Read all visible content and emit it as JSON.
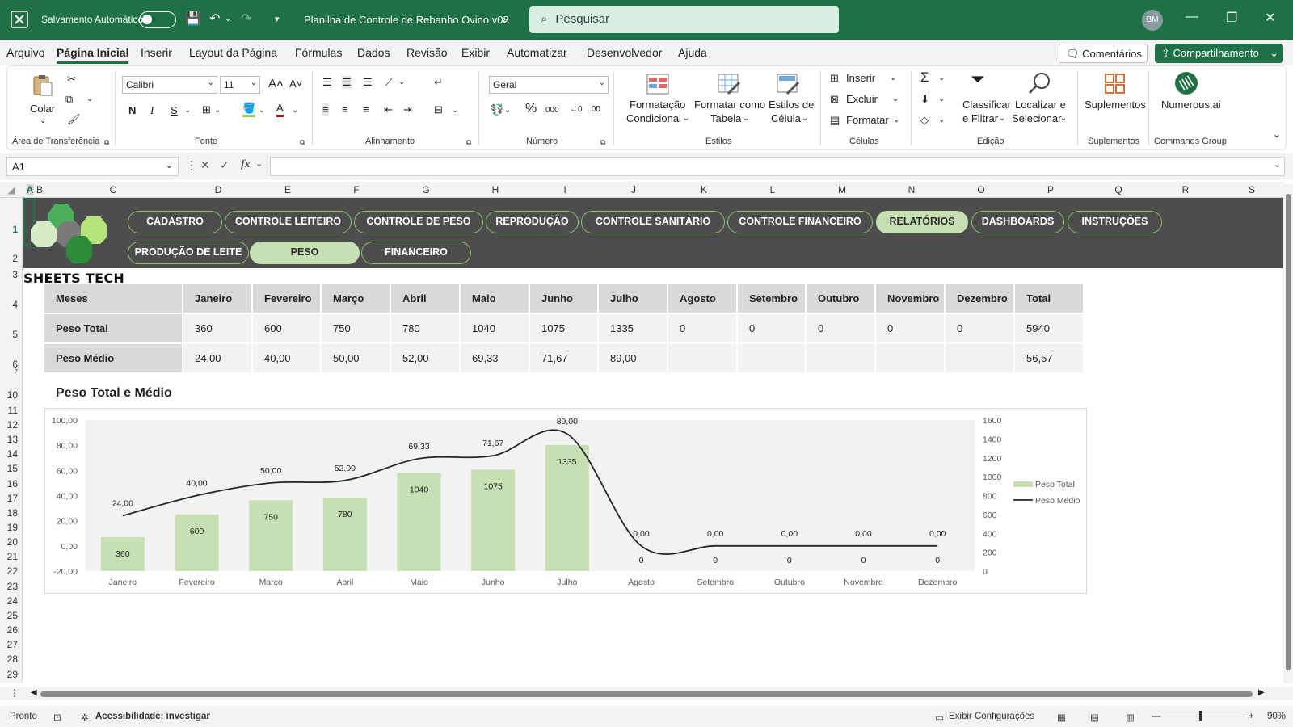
{
  "titlebar": {
    "autosave_label": "Salvamento Automático",
    "doc_title": "Planilha de Controle de Rebanho Ovino v08",
    "search_placeholder": "Pesquisar",
    "avatar_initials": "BM"
  },
  "menu": {
    "items": [
      "Arquivo",
      "Página Inicial",
      "Inserir",
      "Layout da Página",
      "Fórmulas",
      "Dados",
      "Revisão",
      "Exibir",
      "Automatizar",
      "Desenvolvedor",
      "Ajuda"
    ],
    "active": "Página Inicial",
    "comments_label": "Comentários",
    "share_label": "Compartilhamento"
  },
  "ribbon": {
    "paste": "Colar",
    "font_name": "Calibri",
    "font_size": "11",
    "bold": "N",
    "italic": "I",
    "underline": "S",
    "number_format": "Geral",
    "cond_format_1": "Formatação",
    "cond_format_2": "Condicional",
    "format_table_1": "Formatar como",
    "format_table_2": "Tabela",
    "cell_styles_1": "Estilos de",
    "cell_styles_2": "Célula",
    "insert": "Inserir",
    "delete": "Excluir",
    "format": "Formatar",
    "sort_1": "Classificar",
    "sort_2": "e Filtrar",
    "find_1": "Localizar e",
    "find_2": "Selecionar",
    "addins": "Suplementos",
    "numerous": "Numerous.ai",
    "groups": {
      "clipboard": "Área de Transferência",
      "font": "Fonte",
      "alignment": "Alinhamento",
      "number": "Número",
      "styles": "Estilos",
      "cells": "Células",
      "editing": "Edição",
      "addins": "Suplementos",
      "commands": "Commands Group"
    }
  },
  "formula": {
    "namebox": "A1",
    "fx": "fx",
    "content": ""
  },
  "columns": [
    "A",
    "B",
    "C",
    "D",
    "E",
    "F",
    "G",
    "H",
    "I",
    "J",
    "K",
    "L",
    "M",
    "N",
    "O",
    "P",
    "Q",
    "R",
    "S"
  ],
  "rows": [
    "1",
    "2",
    "3",
    "4",
    "5",
    "6",
    "7",
    "10",
    "11",
    "12",
    "13",
    "14",
    "15",
    "16",
    "17",
    "18",
    "19",
    "20",
    "21",
    "22",
    "23",
    "24",
    "25",
    "26",
    "27",
    "28",
    "29"
  ],
  "nav": {
    "row1": [
      "CADASTRO",
      "CONTROLE LEITEIRO",
      "CONTROLE DE PESO",
      "REPRODUÇÃO",
      "CONTROLE SANITÁRIO",
      "CONTROLE FINANCEIRO",
      "RELATÓRIOS",
      "DASHBOARDS",
      "INSTRUÇÕES"
    ],
    "row2": [
      "PRODUÇÃO DE LEITE",
      "PESO",
      "FINANCEIRO"
    ],
    "active_row1": "RELATÓRIOS",
    "active_row2": "PESO"
  },
  "brand": "SHEETS TECH",
  "table": {
    "header": [
      "Meses",
      "Janeiro",
      "Fevereiro",
      "Março",
      "Abril",
      "Maio",
      "Junho",
      "Julho",
      "Agosto",
      "Setembro",
      "Outubro",
      "Novembro",
      "Dezembro",
      "Total"
    ],
    "rows": [
      {
        "label": "Peso Total",
        "values": [
          "360",
          "600",
          "750",
          "780",
          "1040",
          "1075",
          "1335",
          "0",
          "0",
          "0",
          "0",
          "0",
          "5940"
        ]
      },
      {
        "label": "Peso Médio",
        "values": [
          "24,00",
          "40,00",
          "50,00",
          "52,00",
          "69,33",
          "71,67",
          "89,00",
          "",
          "",
          "",
          "",
          "",
          "56,57"
        ]
      }
    ]
  },
  "chart_data": {
    "type": "bar",
    "title": "Peso Total e Médio",
    "categories": [
      "Janeiro",
      "Fevereiro",
      "Março",
      "Abril",
      "Maio",
      "Junho",
      "Julho",
      "Agosto",
      "Setembro",
      "Outubro",
      "Novembro",
      "Dezembro"
    ],
    "series": [
      {
        "name": "Peso Total",
        "type": "bar",
        "axis": "right",
        "values": [
          360,
          600,
          750,
          780,
          1040,
          1075,
          1335,
          0,
          0,
          0,
          0,
          0
        ],
        "labels": [
          "360",
          "600",
          "750",
          "780",
          "1040",
          "1075",
          "1335",
          "0",
          "0",
          "0",
          "0",
          "0"
        ],
        "color": "#c6e0b4"
      },
      {
        "name": "Peso Médio",
        "type": "line",
        "axis": "left",
        "values": [
          24,
          40,
          50,
          52,
          69.33,
          71.67,
          89,
          0,
          0,
          0,
          0,
          0
        ],
        "labels": [
          "24,00",
          "40,00",
          "50,00",
          "52,00",
          "69,33",
          "71,67",
          "89,00",
          "0,00",
          "0,00",
          "0,00",
          "0,00",
          "0,00"
        ],
        "color": "#262626"
      }
    ],
    "y_left": {
      "min": -20,
      "max": 100,
      "ticks": [
        "100,00",
        "80,00",
        "60,00",
        "40,00",
        "20,00",
        "0,00",
        "-20,00"
      ]
    },
    "y_right": {
      "min": 0,
      "max": 1600,
      "ticks": [
        "1600",
        "1400",
        "1200",
        "1000",
        "800",
        "600",
        "400",
        "200",
        "0"
      ]
    },
    "legend_position": "right",
    "grid": false
  },
  "status": {
    "ready": "Pronto",
    "accessibility": "Acessibilidade: investigar",
    "display_settings": "Exibir Configurações",
    "zoom": "90%"
  }
}
